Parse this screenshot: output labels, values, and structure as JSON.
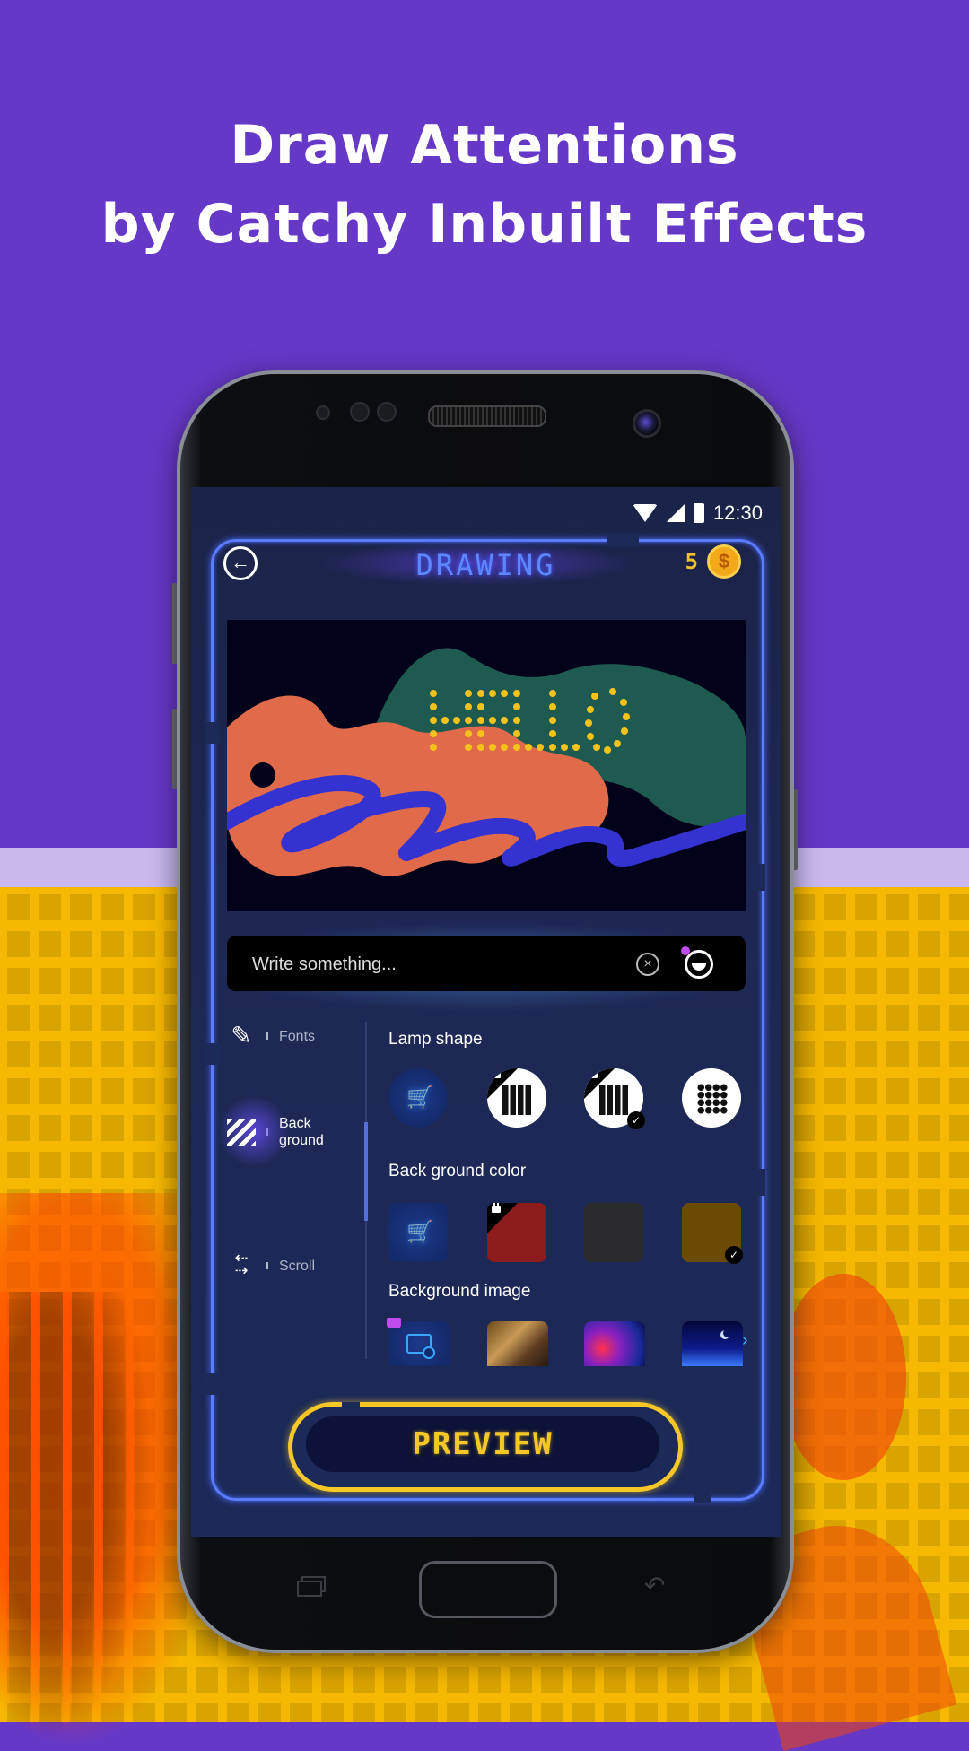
{
  "headline": {
    "line1": "Draw Attentions",
    "line2": "by Catchy Inbuilt Effects"
  },
  "status_bar": {
    "time": "12:30",
    "icons": [
      "wifi-icon",
      "cellular-signal-icon",
      "battery-icon"
    ]
  },
  "app": {
    "title": "DRAWING",
    "back_icon": "arrow-left-circle-icon",
    "coins": "5",
    "coin_icon": "dollar-coin-icon",
    "colors": {
      "neon_frame": "#5b7cff",
      "title": "#5d86ff",
      "coin": "#f2c12e",
      "preview": "#f5c828"
    }
  },
  "canvas": {
    "text": "HELLO",
    "text_color": "#f5c21a",
    "background": "#02031a"
  },
  "text_input": {
    "placeholder": "Write something...",
    "value": "",
    "clear_icon": "clear-circle-icon",
    "emoji_icon": "emoji-smile-icon"
  },
  "tabs": [
    {
      "label": "Fonts",
      "icon": "pencil-icon",
      "active": false
    },
    {
      "label": "Back ground",
      "line1": "Back",
      "line2": "ground",
      "icon": "stripes-icon",
      "active": true
    },
    {
      "label": "Scroll",
      "icon": "scroll-arrows-icon",
      "active": false
    }
  ],
  "sections": {
    "lamp_shape": {
      "title": "Lamp shape",
      "options": [
        {
          "type": "store",
          "icon": "cart-icon"
        },
        {
          "type": "square-lamp",
          "locked": true,
          "selected": false
        },
        {
          "type": "square-lamp-small",
          "locked": true,
          "selected": true
        },
        {
          "type": "round-lamp",
          "locked": false,
          "selected": false
        }
      ]
    },
    "background_color": {
      "title": "Back ground color",
      "options": [
        {
          "type": "store",
          "icon": "cart-icon"
        },
        {
          "color": "#8e1c1c",
          "locked": true,
          "selected": false
        },
        {
          "color": "#2b2b2e",
          "locked": false,
          "selected": false
        },
        {
          "color": "#6b4a06",
          "locked": false,
          "selected": true
        }
      ]
    },
    "background_image": {
      "title": "Background image",
      "options": [
        {
          "type": "add-image",
          "icon": "add-image-icon",
          "premium": true
        },
        {
          "type": "image",
          "name": "group-selfie-photo"
        },
        {
          "type": "image",
          "name": "galaxy-nebula-photo"
        },
        {
          "type": "image",
          "name": "night-sky-moon-photo"
        }
      ],
      "more_icon": "chevron-right-icon"
    }
  },
  "preview_button": {
    "label": "PREVIEW"
  }
}
